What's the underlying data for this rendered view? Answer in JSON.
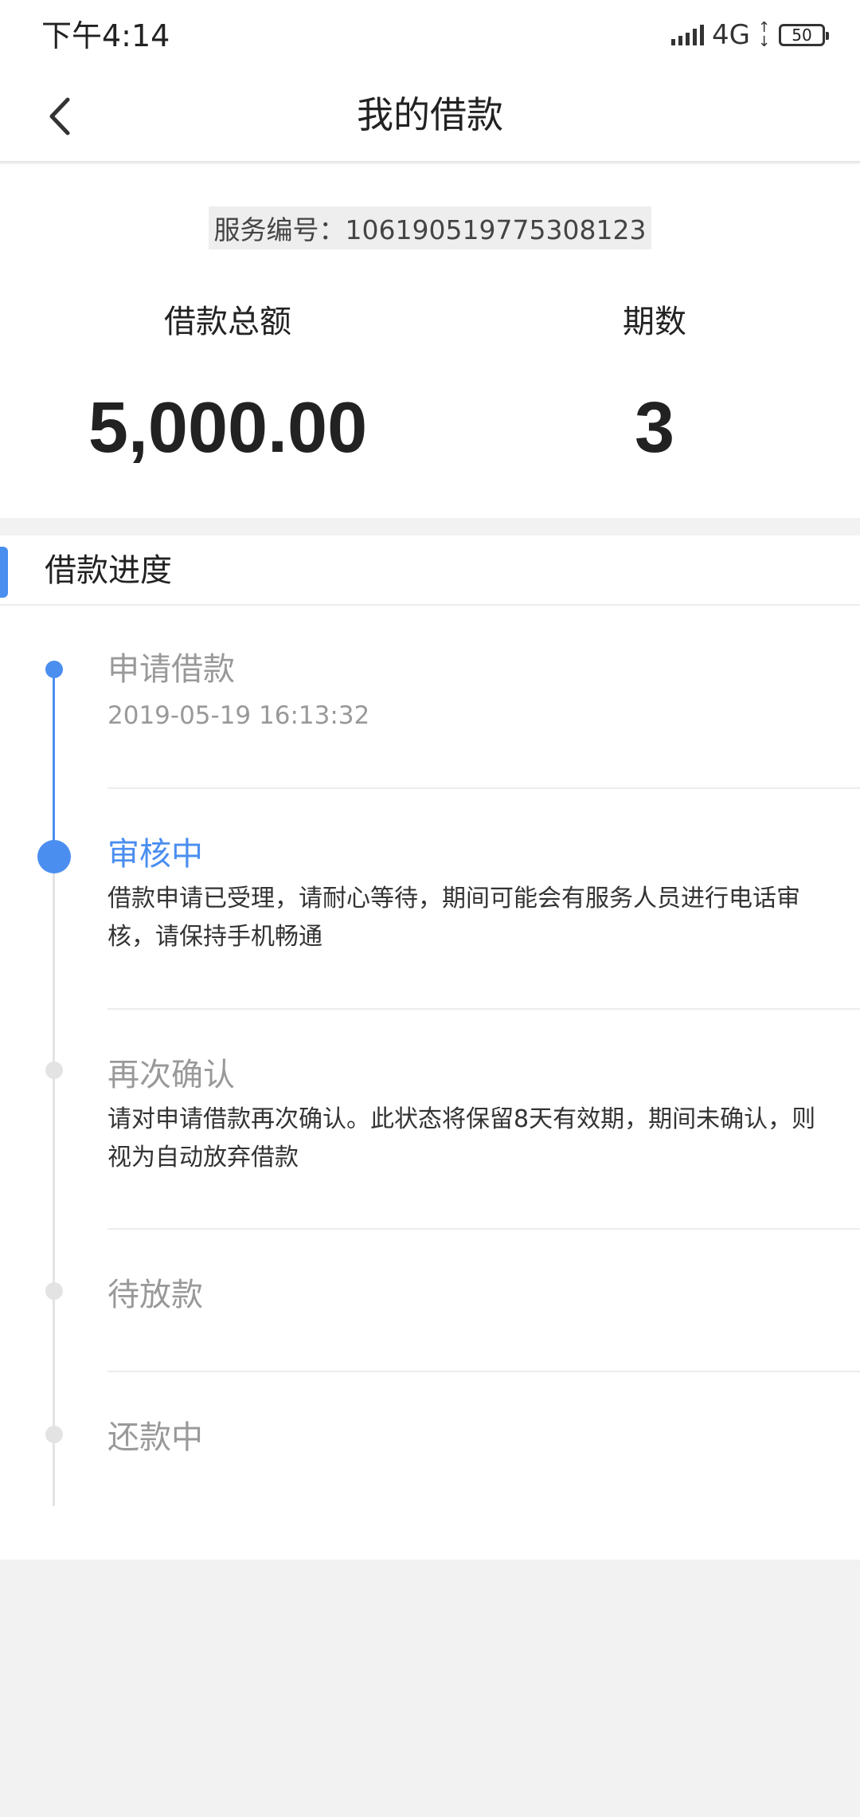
{
  "status_bar": {
    "time": "下午4:14",
    "network": "4G",
    "battery": "50"
  },
  "nav": {
    "title": "我的借款"
  },
  "summary": {
    "service_number": "服务编号：106190519775308123",
    "amount_label": "借款总额",
    "amount_value": "5,000.00",
    "periods_label": "期数",
    "periods_value": "3"
  },
  "progress": {
    "title": "借款进度",
    "accent_color": "#4a8ef0",
    "steps": [
      {
        "title": "申请借款",
        "time": "2019-05-19 16:13:32",
        "status": "done"
      },
      {
        "title": "审核中",
        "desc": "借款申请已受理，请耐心等待，期间可能会有服务人员进行电话审核，请保持手机畅通",
        "status": "current"
      },
      {
        "title": "再次确认",
        "desc": "请对申请借款再次确认。此状态将保留8天有效期，期间未确认，则视为自动放弃借款",
        "status": "pending"
      },
      {
        "title": "待放款",
        "status": "pending"
      },
      {
        "title": "还款中",
        "status": "pending"
      }
    ]
  }
}
